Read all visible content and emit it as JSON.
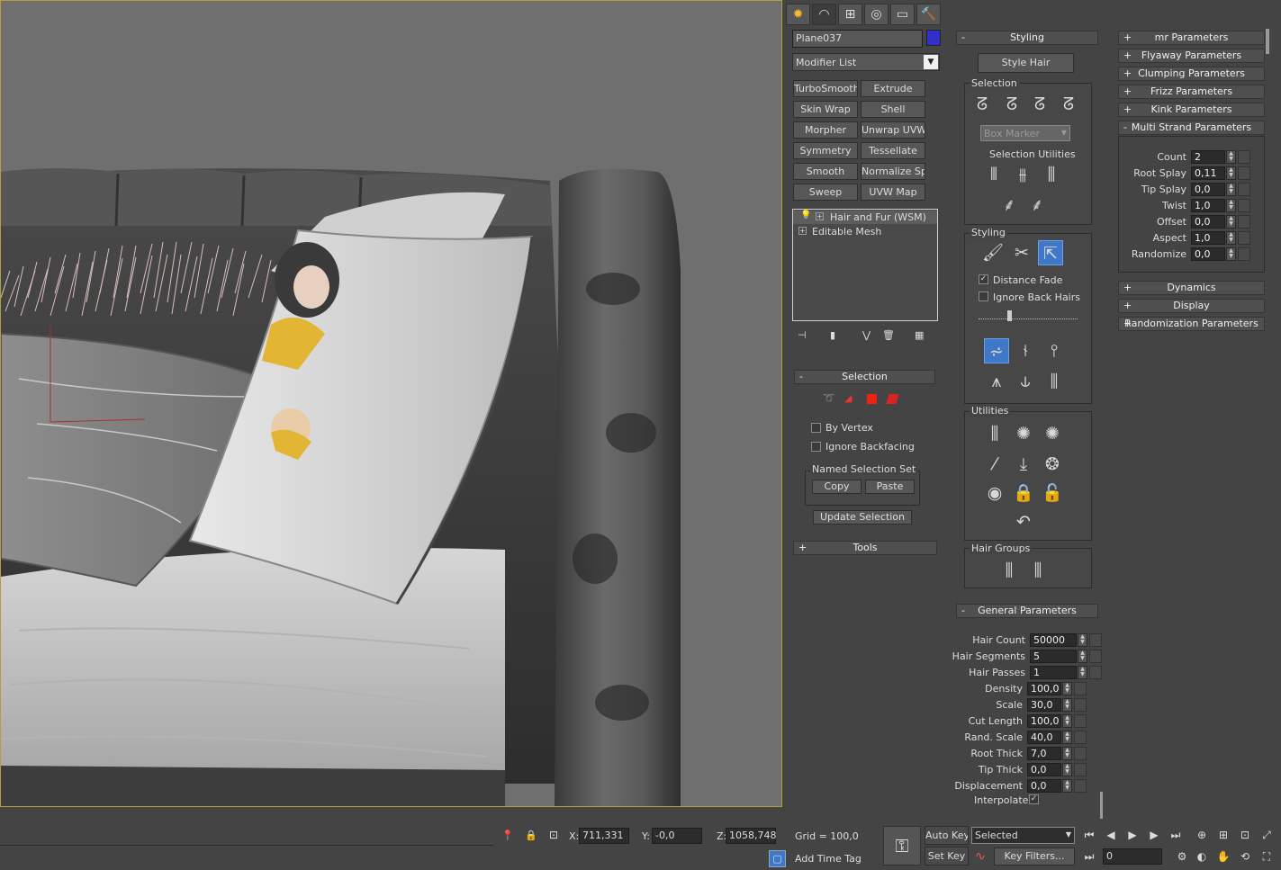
{
  "viewport": {
    "label": "Perspective viewport"
  },
  "tabs": [
    {
      "name": "create-tab-icon",
      "glyph": "✹"
    },
    {
      "name": "modify-tab-icon",
      "glyph": "◠"
    },
    {
      "name": "hierarchy-tab-icon",
      "glyph": "⊞"
    },
    {
      "name": "motion-tab-icon",
      "glyph": "◎"
    },
    {
      "name": "display-tab-icon",
      "glyph": "▭"
    },
    {
      "name": "utilities-tab-icon",
      "glyph": "🔨"
    }
  ],
  "object_name": "Plane037",
  "object_color": "#3131c9",
  "modifier_list": "Modifier List",
  "modifier_buttons": [
    "TurboSmooth",
    "Extrude",
    "Skin Wrap",
    "Shell",
    "Morpher",
    "Unwrap UVW",
    "Symmetry",
    "Tessellate",
    "Smooth",
    "Normalize Spl.",
    "Sweep",
    "UVW Map"
  ],
  "stack": [
    "Hair and Fur (WSM)",
    "Editable Mesh"
  ],
  "selection_rollout": {
    "title": "Selection",
    "by_vertex": "By Vertex",
    "ignore_backfacing": "Ignore Backfacing",
    "named_set": "Named Selection Set",
    "copy": "Copy",
    "paste": "Paste",
    "update": "Update Selection"
  },
  "tools_rollout": "Tools",
  "styling": {
    "title": "Styling",
    "style_hair": "Style Hair",
    "selection_group": "Selection",
    "box_marker": "Box Marker",
    "selection_utilities": "Selection Utilities",
    "styling_group": "Styling",
    "distance_fade": "Distance Fade",
    "ignore_back_hairs": "Ignore Back Hairs",
    "utilities_group": "Utilities",
    "hair_groups": "Hair Groups"
  },
  "general_parameters": {
    "title": "General Parameters",
    "rows": [
      {
        "label": "Hair Count",
        "value": "50000"
      },
      {
        "label": "Hair Segments",
        "value": "5"
      },
      {
        "label": "Hair Passes",
        "value": "1"
      },
      {
        "label": "Density",
        "value": "100,0"
      },
      {
        "label": "Scale",
        "value": "30,0"
      },
      {
        "label": "Cut Length",
        "value": "100,0"
      },
      {
        "label": "Rand. Scale",
        "value": "40,0"
      },
      {
        "label": "Root Thick",
        "value": "7,0"
      },
      {
        "label": "Tip Thick",
        "value": "0,0"
      },
      {
        "label": "Displacement",
        "value": "0,0"
      }
    ],
    "interpolate": "Interpolate"
  },
  "right_rollouts": [
    "mr Parameters",
    "Flyaway Parameters",
    "Clumping Parameters",
    "Frizz Parameters",
    "Kink Parameters",
    "Multi Strand Parameters"
  ],
  "multi_strand": {
    "rows": [
      {
        "label": "Count",
        "value": "2"
      },
      {
        "label": "Root Splay",
        "value": "0,11"
      },
      {
        "label": "Tip Splay",
        "value": "0,0"
      },
      {
        "label": "Twist",
        "value": "1,0"
      },
      {
        "label": "Offset",
        "value": "0,0"
      },
      {
        "label": "Aspect",
        "value": "1,0"
      },
      {
        "label": "Randomize",
        "value": "0,0"
      }
    ]
  },
  "lower_rollouts": [
    "Dynamics",
    "Display",
    "Randomization Parameters"
  ],
  "status": {
    "x_label": "X:",
    "x": "711,331",
    "y_label": "Y:",
    "y": "-0,0",
    "z_label": "Z:",
    "z": "1058,748",
    "grid": "Grid = 100,0",
    "add_time_tag": "Add Time Tag",
    "auto_key": "Auto Key",
    "set_key": "Set Key",
    "selected": "Selected",
    "key_filters": "Key Filters...",
    "frame": "0"
  }
}
